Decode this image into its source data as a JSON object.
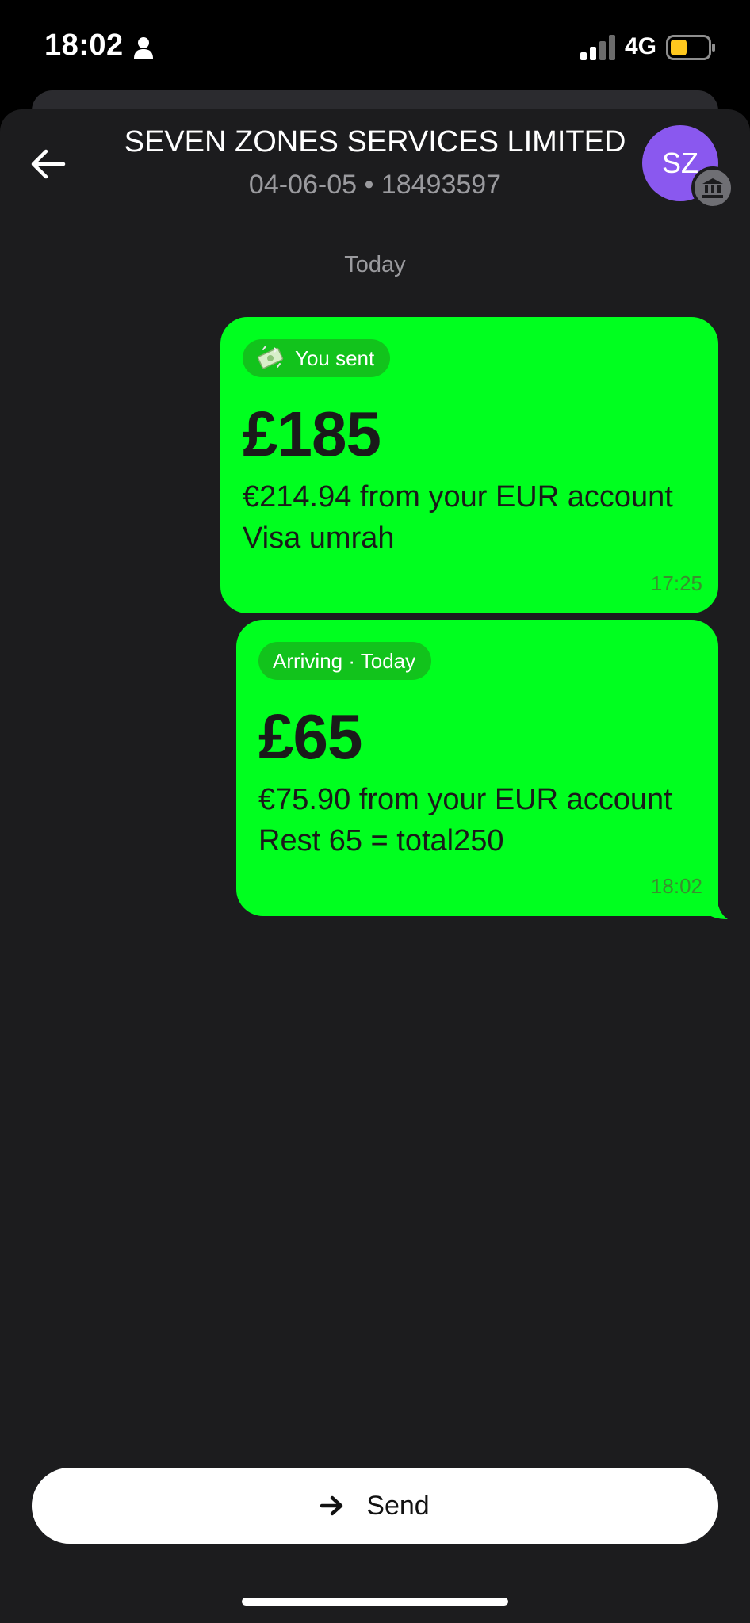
{
  "status_bar": {
    "time": "18:02",
    "network": "4G",
    "battery_color": "#ffc81e"
  },
  "header": {
    "title": "SEVEN ZONES SERVICES LIMITED",
    "subtitle": "04-06-05 • 18493597",
    "avatar_initials": "SZ",
    "avatar_color": "#8a58ef",
    "back_icon": "arrow-left-icon",
    "badge_icon": "bank-icon"
  },
  "conversation": {
    "date_divider": "Today",
    "bubble_color": "#00ff1f",
    "messages": [
      {
        "status_label": "You sent",
        "status_icon": "money-emoji-icon",
        "amount": "£185",
        "detail": "€214.94 from your EUR account",
        "note": "Visa umrah",
        "time": "17:25"
      },
      {
        "status_label": "Arriving · Today",
        "amount": "£65",
        "detail": "€75.90 from your EUR account",
        "note": "Rest 65 = total250",
        "time": "18:02"
      }
    ]
  },
  "footer": {
    "send_label": "Send",
    "send_icon": "arrow-right-icon"
  }
}
